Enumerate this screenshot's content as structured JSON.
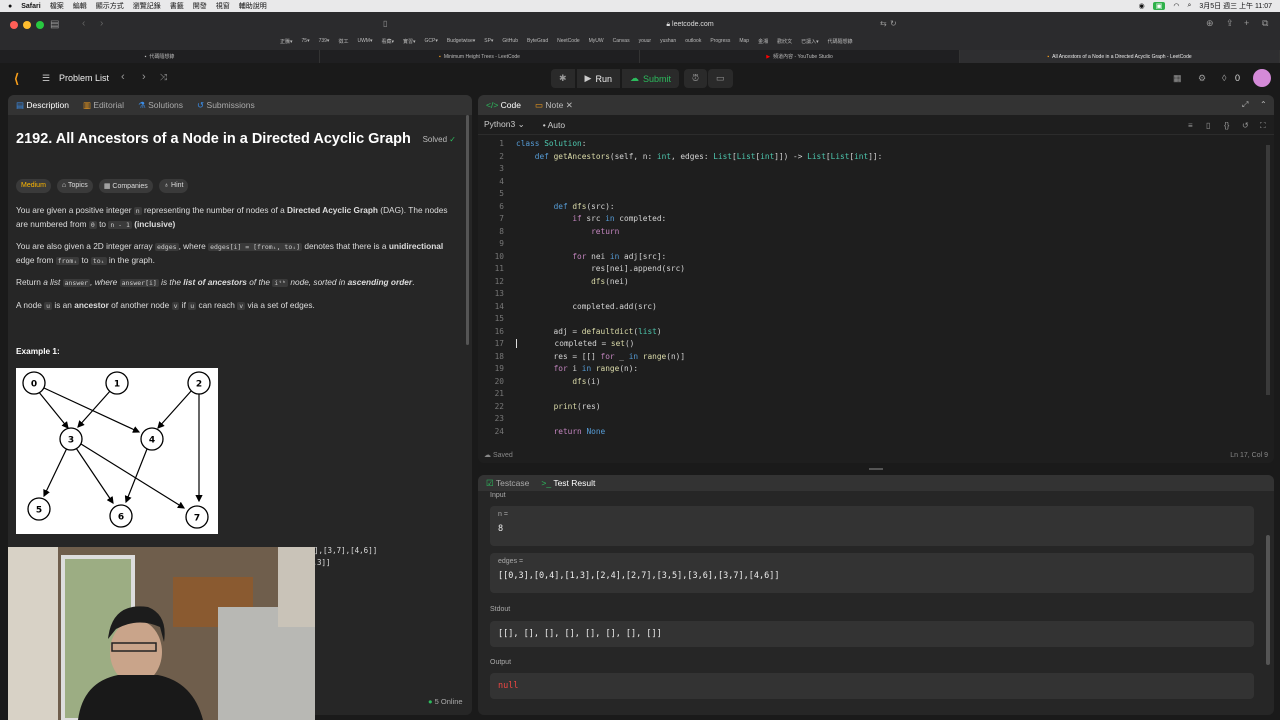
{
  "macbar": {
    "apple": "",
    "app": "Safari",
    "menus": [
      "檔案",
      "編輯",
      "顯示方式",
      "瀏覽記錄",
      "書籤",
      "開發",
      "視窗",
      "輔助說明"
    ],
    "clock": "3月5日 週三 上午 11:07"
  },
  "safari": {
    "url": "leetcode.com",
    "bookmarks": [
      "正騰▾",
      "75▾",
      "739▾",
      "徵工",
      "UWM▾",
      "看藏▾",
      "實習▾",
      "GCP▾",
      "Budgetwise▾",
      "SP▾",
      "GitHub",
      "ByteGrad",
      "NeetCode",
      "MyUW",
      "Canvas",
      "youur",
      "yushan",
      "outlook",
      "Progress",
      "Map",
      "金湘",
      "歡欣文",
      "已讓入▾",
      "代碼隨想錄"
    ]
  },
  "tabs": [
    {
      "label": "代碼隨想錄"
    },
    {
      "label": "Minimum Height Trees - LeetCode"
    },
    {
      "label": "頻道內容 - YouTube Studio"
    },
    {
      "label": "All Ancestors of a Node in a Directed Acyclic Graph - LeetCode",
      "active": true
    }
  ],
  "header": {
    "problem_list": "Problem List",
    "run": "Run",
    "submit": "Submit",
    "streak": "0"
  },
  "left": {
    "tabs": [
      "Description",
      "Editorial",
      "Solutions",
      "Submissions"
    ],
    "title": "2192. All Ancestors of a Node in a Directed Acyclic Graph",
    "solved": "Solved",
    "chips": [
      "Medium",
      "Topics",
      "Companies",
      "Hint"
    ],
    "p1a": "You are given a positive integer ",
    "p1b": "n",
    "p1c": " representing the number of nodes of a ",
    "p1d": "Directed Acyclic Graph",
    "p1e": " (DAG). The nodes are numbered from ",
    "p1f": "0",
    "p1g": " to ",
    "p1h": "n - 1",
    "p1i": " (inclusive)",
    ".": ".",
    "p2a": "You are also given a 2D integer array ",
    "p2b": "edges",
    "p2c": ", where ",
    "p2d": "edges[i] = [fromᵢ, toᵢ]",
    "p2e": " denotes that there is a ",
    "p2f": "unidirectional",
    "p2g": " edge from ",
    "p2h": "fromᵢ",
    "p2i": " to ",
    "p2j": "toᵢ",
    "p2k": " in the graph.",
    "p3a": "Return ",
    "p3b": "a list ",
    "p3c": "answer",
    "p3d": ", where ",
    "p3e": "answer[i]",
    "p3f": " is the ",
    "p3g": "list of ancestors",
    "p3h": " of the ",
    "p3i": "iᵗʰ",
    "p3j": " node, sorted in ",
    "p3k": "ascending order",
    "p4a": "A node ",
    "p4b": "u",
    "p4c": " is an ",
    "p4d": "ancestor",
    "p4e": " of another node ",
    "p4f": "v",
    "p4g": " if ",
    "p4h": "u",
    "p4i": " can reach ",
    "p4j": "v",
    "p4k": " via a set of edges.",
    "example": "Example 1:",
    "input_line": "Input: n = 8, edgeList = [[0,3],[0,4],[1,3],[2,4],[2,7],[3,5],[3,6],[3,7],[4,6]]",
    "output_line": "2,3]]",
    "nodes": [
      "0",
      "1",
      "2",
      "3",
      "4",
      "5",
      "6",
      "7"
    ]
  },
  "editor": {
    "tabs": [
      "Code",
      "Note"
    ],
    "language": "Python3",
    "mode": "Auto",
    "status": "Saved",
    "cursor": "Ln 17, Col 9"
  },
  "code_lines": [
    "class Solution:",
    "    def getAncestors(self, n: int, edges: List[List[int]]) -> List[List[int]]:",
    "",
    "",
    "",
    "        def dfs(src):",
    "            if src in completed:",
    "                return",
    "",
    "            for nei in adj[src]:",
    "                res[nei].append(src)",
    "                dfs(nei)",
    "",
    "            completed.add(src)",
    "",
    "        adj = defaultdict(list)",
    "        completed = set()",
    "        res = [[] for _ in range(n)]",
    "        for i in range(n):",
    "            dfs(i)",
    "",
    "        print(res)",
    "",
    "        return None"
  ],
  "bottom": {
    "tabs": [
      "Testcase",
      "Test Result"
    ],
    "input_label": "Input",
    "n_label": "n =",
    "n_value": "8",
    "edges_label": "edges =",
    "edges_value": "[[0,3],[0,4],[1,3],[2,4],[2,7],[3,5],[3,6],[3,7],[4,6]]",
    "stdout_label": "Stdout",
    "stdout_value": "[[], [], [], [], [], [], [], []]",
    "output_label": "Output",
    "output_value": "null"
  },
  "online": "5 Online"
}
